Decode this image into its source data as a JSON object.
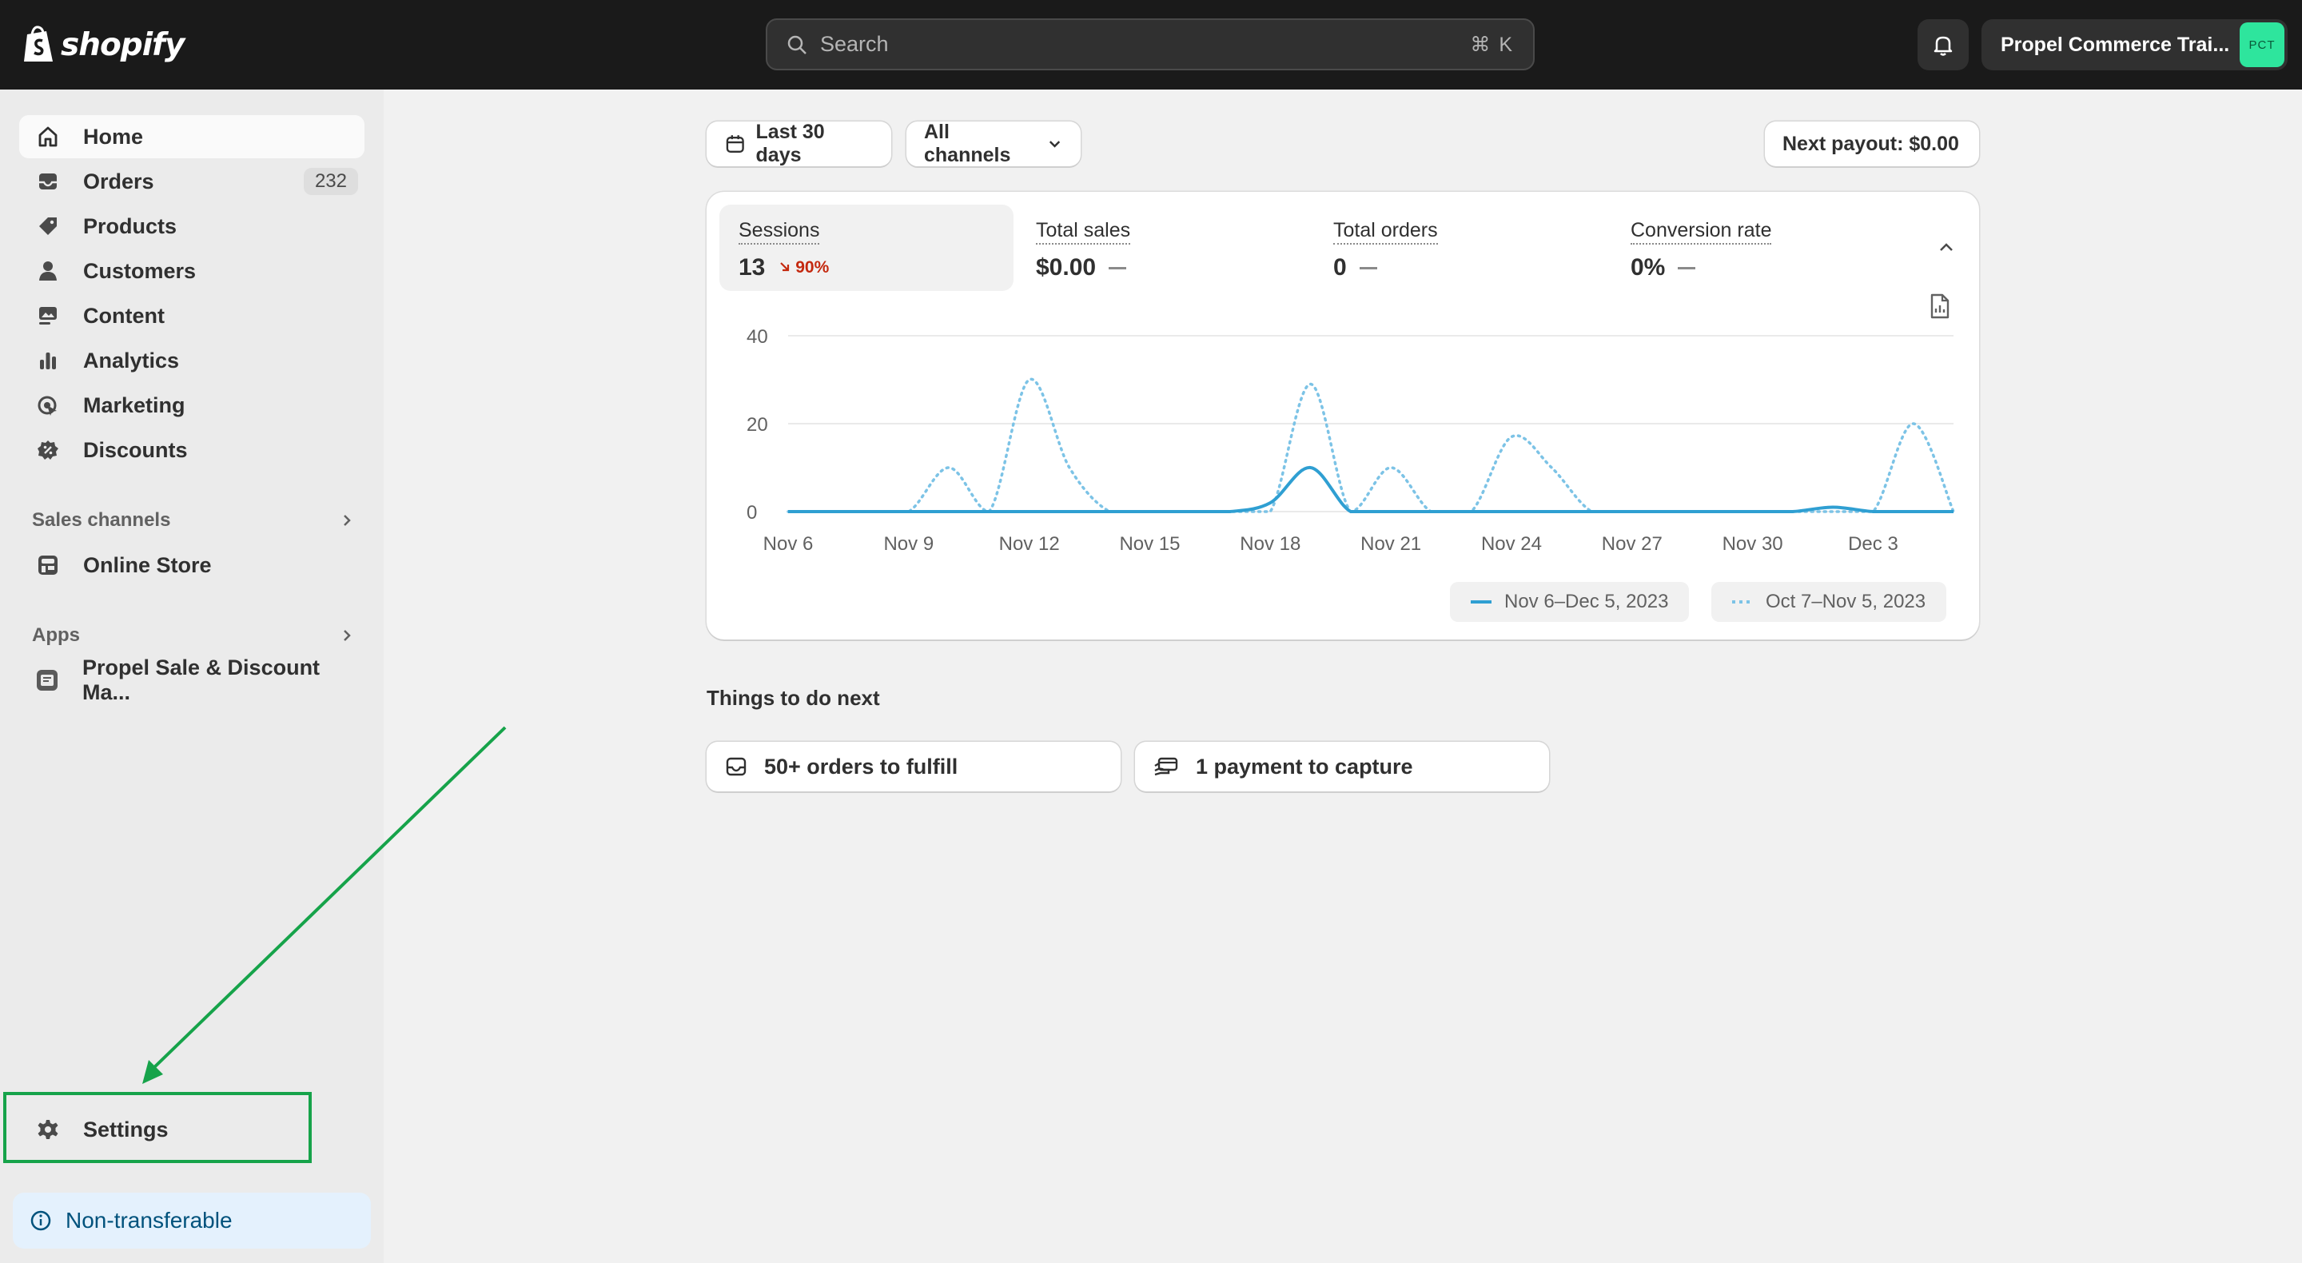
{
  "topbar": {
    "logo_text": "shopify",
    "search_placeholder": "Search",
    "search_shortcut": "⌘ K",
    "store_name": "Propel Commerce Trai...",
    "store_initials": "PCT"
  },
  "sidebar": {
    "items": [
      {
        "label": "Home",
        "icon": "home-icon",
        "active": true
      },
      {
        "label": "Orders",
        "icon": "orders-icon",
        "badge": "232"
      },
      {
        "label": "Products",
        "icon": "tag-icon"
      },
      {
        "label": "Customers",
        "icon": "person-icon"
      },
      {
        "label": "Content",
        "icon": "content-icon"
      },
      {
        "label": "Analytics",
        "icon": "bar-chart-icon"
      },
      {
        "label": "Marketing",
        "icon": "marketing-icon"
      },
      {
        "label": "Discounts",
        "icon": "discount-icon"
      }
    ],
    "sales_channels_title": "Sales channels",
    "online_store_label": "Online Store",
    "apps_title": "Apps",
    "app_label": "Propel Sale & Discount Ma...",
    "settings_label": "Settings",
    "non_transferable_label": "Non-transferable"
  },
  "filters": {
    "date_range_label": "Last 30 days",
    "channels_label": "All channels",
    "next_payout_label": "Next payout: $0.00"
  },
  "metrics": [
    {
      "label": "Sessions",
      "value": "13",
      "delta": "90%",
      "selected": true
    },
    {
      "label": "Total sales",
      "value": "$0.00"
    },
    {
      "label": "Total orders",
      "value": "0"
    },
    {
      "label": "Conversion rate",
      "value": "0%"
    }
  ],
  "chart_data": {
    "type": "line",
    "y_ticks": [
      "40",
      "20",
      "0"
    ],
    "ylim": [
      0,
      40
    ],
    "x_ticks": [
      "Nov 6",
      "Nov 9",
      "Nov 12",
      "Nov 15",
      "Nov 18",
      "Nov 21",
      "Nov 24",
      "Nov 27",
      "Nov 30",
      "Dec 3"
    ],
    "x": [
      0,
      1,
      2,
      3,
      4,
      5,
      6,
      7,
      8,
      9,
      10,
      11,
      12,
      13,
      14,
      15,
      16,
      17,
      18,
      19,
      20,
      21,
      22,
      23,
      24,
      25,
      26,
      27,
      28,
      29
    ],
    "grid": true,
    "series": [
      {
        "name": "Nov 6–Dec 5, 2023",
        "style": "solid",
        "color": "#2f9fd2",
        "values": [
          0,
          0,
          0,
          0,
          0,
          0,
          0,
          0,
          0,
          0,
          0,
          0,
          2,
          10,
          0,
          0,
          0,
          0,
          0,
          0,
          0,
          0,
          0,
          0,
          0,
          0,
          1,
          0,
          0,
          0
        ]
      },
      {
        "name": "Oct 7–Nov 5, 2023",
        "style": "dotted",
        "color": "#7cc3e6",
        "values": [
          0,
          0,
          0,
          0,
          10,
          0,
          30,
          10,
          0,
          0,
          0,
          0,
          0,
          29,
          0,
          10,
          0,
          0,
          17,
          10,
          0,
          0,
          0,
          0,
          0,
          0,
          0,
          0,
          20,
          0
        ]
      }
    ]
  },
  "things_to_do": {
    "title": "Things to do next",
    "tasks": [
      {
        "label": "50+ orders to fulfill",
        "icon": "inbox-icon"
      },
      {
        "label": "1 payment to capture",
        "icon": "payment-icon"
      }
    ]
  },
  "annotation": {
    "color": "#16a34a"
  }
}
